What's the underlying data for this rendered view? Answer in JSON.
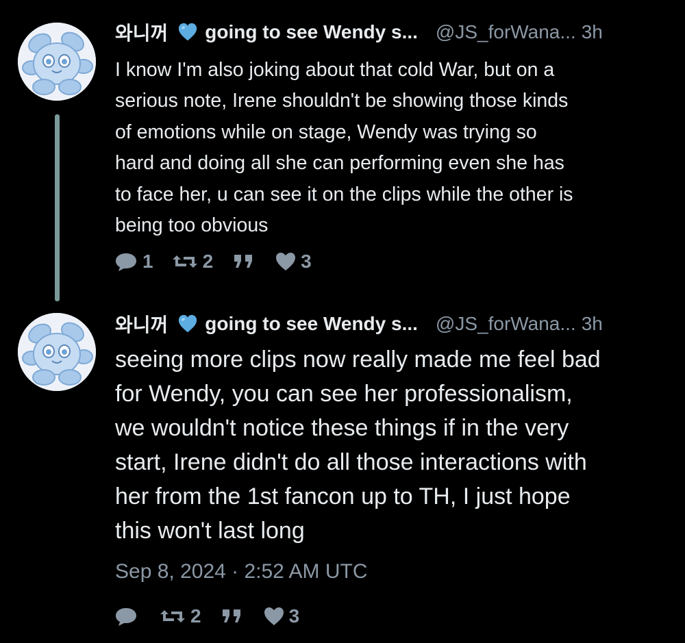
{
  "tweets": [
    {
      "display_name": "와니꺼",
      "heart": "💙",
      "bio_snippet": "going to see Wendy s...",
      "handle": "@JS_forWana...",
      "time": "3h",
      "lines": [
        "I know I'm also joking about that cold War, but on a",
        "serious note, Irene shouldn't be showing those kinds",
        "of emotions while on stage, Wendy was trying so",
        "hard and doing all she can performing even she has",
        "to face her, u can see it on the clips while the other is",
        "being too obvious"
      ],
      "replies": "1",
      "retweets": "2",
      "likes": "3"
    },
    {
      "display_name": "와니꺼",
      "heart": "💙",
      "bio_snippet": "going to see Wendy s...",
      "handle": "@JS_forWana...",
      "time": "3h",
      "lines": [
        "seeing more clips now really made me feel bad",
        "for Wendy, you can see her professionalism,",
        "we wouldn't notice these things if in the very",
        "start, Irene didn't do all those interactions with",
        "her from the 1st fancon up to TH, I just hope",
        "this won't last long"
      ],
      "timestamp": "Sep 8, 2024 · 2:52 AM UTC",
      "replies": "",
      "retweets": "2",
      "likes": "3"
    }
  ],
  "colors": {
    "background": "#000000",
    "text": "#e8ecef",
    "muted": "#8b98a5",
    "thread_line": "#7a9a99",
    "heart_blue": "#5dade2"
  },
  "icons": [
    "avatar-flower",
    "blue-heart-emoji",
    "reply-icon",
    "retweet-icon",
    "quote-icon",
    "like-icon"
  ]
}
